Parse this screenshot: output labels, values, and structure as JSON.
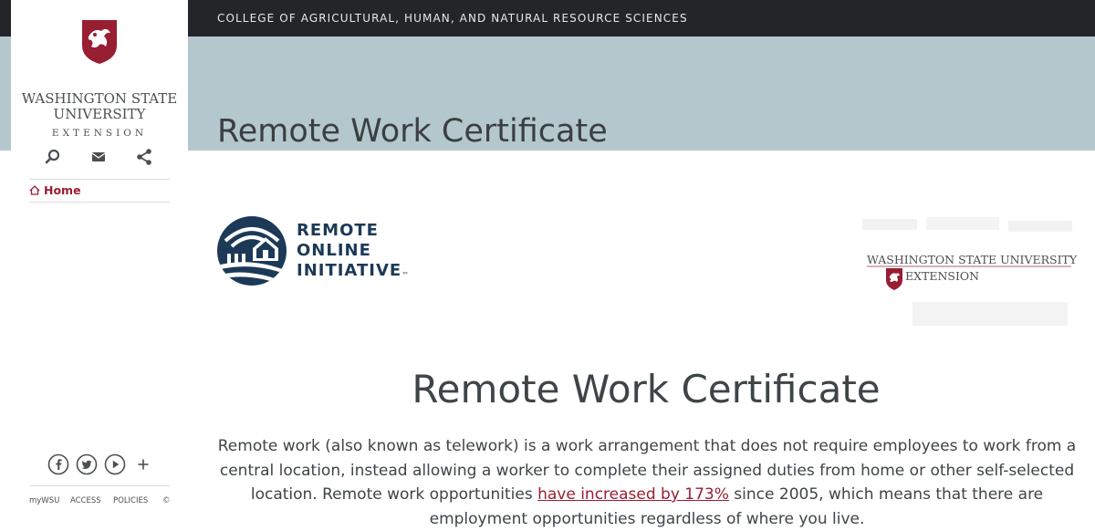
{
  "header": {
    "college_link": "COLLEGE OF AGRICULTURAL, HUMAN, AND NATURAL RESOURCE SCIENCES",
    "banner_title": "Remote Work Certificate"
  },
  "sidebar": {
    "logo_line1": "WASHINGTON STATE",
    "logo_line2": "UNIVERSITY",
    "logo_line3": "EXTENSION",
    "icons": [
      "search-icon",
      "mail-icon",
      "share-icon"
    ],
    "nav": [
      {
        "label": "Home",
        "icon": "home-icon"
      }
    ],
    "social": [
      "facebook-icon",
      "twitter-icon",
      "youtube-icon",
      "plus-icon"
    ],
    "footer_links": [
      "myWSU",
      "ACCESS",
      "POLICIES",
      "©"
    ]
  },
  "logos": {
    "roi_line1": "REMOTE",
    "roi_line2": "ONLINE",
    "roi_line3": "INITIATIVE",
    "roi_tm": "™",
    "wsu_ext_name": "WASHINGTON STATE UNIVERSITY",
    "wsu_ext_ext": "EXTENSION"
  },
  "content": {
    "heading": "Remote Work Certificate",
    "intro_before": "Remote work (also known as telework) is a work arrangement that does not require employees to work from a central location, instead allowing a worker to complete their assigned duties from home or other self-selected location. Remote work opportunities ",
    "intro_link": "have increased by 173%",
    "intro_after": " since 2005, which means that there are employment opportunities regardless of where you live."
  },
  "colors": {
    "crimson": "#981e32",
    "topbar": "#232629",
    "banner": "#b4c7cc",
    "navy": "#1c3a57"
  }
}
